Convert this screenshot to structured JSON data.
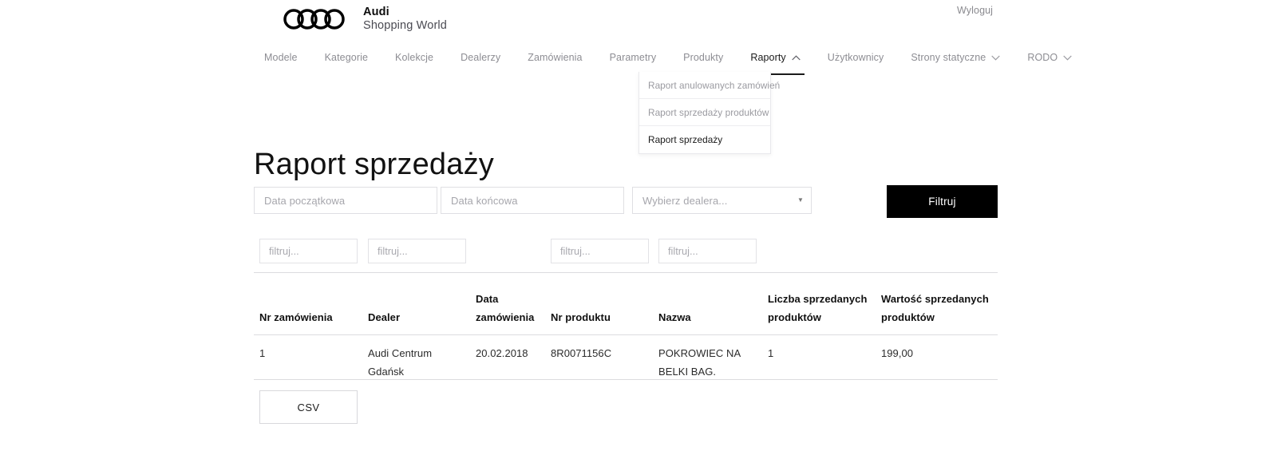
{
  "header": {
    "logout_label": "Wyloguj",
    "brand_line1": "Audi",
    "brand_line2": "Shopping World",
    "logo_icon": "audi-rings-logo"
  },
  "nav": {
    "items": [
      {
        "label": "Modele",
        "icon": null,
        "active": false
      },
      {
        "label": "Kategorie",
        "icon": null,
        "active": false
      },
      {
        "label": "Kolekcje",
        "icon": null,
        "active": false
      },
      {
        "label": "Dealerzy",
        "icon": null,
        "active": false
      },
      {
        "label": "Zamówienia",
        "icon": null,
        "active": false
      },
      {
        "label": "Parametry",
        "icon": null,
        "active": false
      },
      {
        "label": "Produkty",
        "icon": null,
        "active": false
      },
      {
        "label": "Raporty",
        "icon": "chevron-up-icon",
        "active": true
      },
      {
        "label": "Użytkownicy",
        "icon": null,
        "active": false
      },
      {
        "label": "Strony statyczne",
        "icon": "chevron-down-icon",
        "active": false
      },
      {
        "label": "RODO",
        "icon": "chevron-down-icon",
        "active": false
      }
    ]
  },
  "dropdown": {
    "open": true,
    "items": [
      {
        "label": "Raport anulowanych zamówień",
        "active": false
      },
      {
        "label": "Raport sprzedaży produktów",
        "active": false
      },
      {
        "label": "Raport sprzedaży",
        "active": true
      }
    ]
  },
  "page": {
    "title": "Raport sprzedaży"
  },
  "filters": {
    "date_start": {
      "value": "",
      "placeholder": "Data początkowa"
    },
    "date_end": {
      "value": "",
      "placeholder": "Data końcowa"
    },
    "dealer": {
      "value": "",
      "placeholder": "Wybierz dealera...",
      "arrow_icon": "caret-down-icon"
    },
    "submit_label": "Filtruj",
    "submit_color": "#000000"
  },
  "column_filters": [
    {
      "value": "",
      "placeholder": "filtruj...",
      "column": "Nr zamówienia"
    },
    {
      "value": "",
      "placeholder": "filtruj...",
      "column": "Dealer"
    },
    {
      "value": "",
      "placeholder": "filtruj...",
      "column": "Nr produktu"
    },
    {
      "value": "",
      "placeholder": "filtruj...",
      "column": "Nazwa"
    }
  ],
  "table": {
    "columns": [
      "Nr zamówienia",
      "Dealer",
      "Data zamówienia",
      "Nr produktu",
      "Nazwa",
      "Liczba sprzedanych produktów",
      "Wartość sprzedanych produktów"
    ],
    "rows": [
      {
        "nr_zamowienia": "1",
        "dealer": "Audi Centrum Gdańsk",
        "data_zamowienia": "20.02.2018",
        "nr_produktu": "8R0071156C",
        "nazwa": "POKROWIEC NA BELKI BAG.",
        "liczba": "1",
        "wartosc": "199,00"
      }
    ]
  },
  "export": {
    "csv_label": "CSV"
  }
}
